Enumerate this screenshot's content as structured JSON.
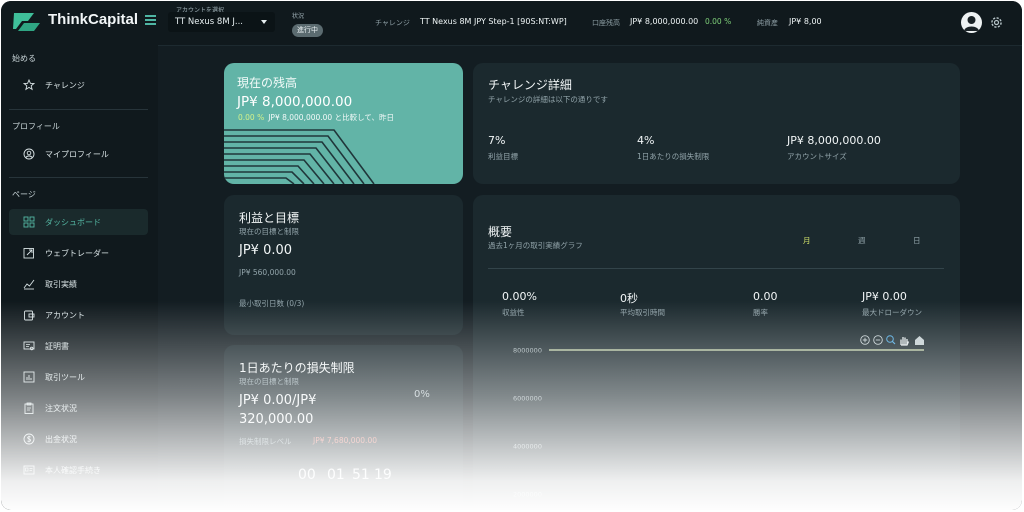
{
  "brand": "ThinkCapital",
  "topbar": {
    "account_label": "アカウントを選択",
    "account_value": "TT Nexus 8M J...",
    "status_label": "状況",
    "status_value": "進行中",
    "challenge_label": "チャレンジ",
    "challenge_value": "TT Nexus 8M JPY Step-1 [90S:NT:WP]",
    "balance_label": "口座残高",
    "balance_value": "JP¥ 8,000,000.00",
    "balance_pct": "0.00 %",
    "equity_label": "純資産",
    "equity_value": "JP¥ 8,00"
  },
  "sidebar": {
    "sections": [
      {
        "title": "始める",
        "items": [
          {
            "label": "チャレンジ",
            "icon": "star-icon"
          }
        ]
      },
      {
        "title": "プロフィール",
        "items": [
          {
            "label": "マイプロフィール",
            "icon": "user-circle-icon"
          }
        ]
      },
      {
        "title": "ページ",
        "items": [
          {
            "label": "ダッシュボード",
            "icon": "grid-icon",
            "active": true
          },
          {
            "label": "ウェブトレーダー",
            "icon": "external-link-icon"
          },
          {
            "label": "取引実績",
            "icon": "chart-line-icon"
          },
          {
            "label": "アカウント",
            "icon": "wallet-icon"
          },
          {
            "label": "証明書",
            "icon": "certificate-icon"
          },
          {
            "label": "取引ツール",
            "icon": "bar-chart-icon"
          },
          {
            "label": "注文状況",
            "icon": "clipboard-icon"
          },
          {
            "label": "出金状況",
            "icon": "dollar-icon"
          },
          {
            "label": "本人確認手続き",
            "icon": "id-card-icon"
          }
        ]
      }
    ]
  },
  "balance_card": {
    "title": "現在の残高",
    "value": "JP¥ 8,000,000.00",
    "pct": "0.00 %",
    "compare": "JP¥ 8,000,000.00 と比較して、昨日"
  },
  "challenge_details": {
    "title": "チャレンジ詳細",
    "subtitle": "チャレンジの詳細は以下の通りです",
    "metrics": [
      {
        "value": "7%",
        "label": "利益目標"
      },
      {
        "value": "4%",
        "label": "1日あたりの損失制限"
      },
      {
        "value": "JP¥ 8,000,000.00",
        "label": "アカウントサイズ"
      }
    ]
  },
  "profit_card": {
    "title": "利益と目標",
    "subtitle": "現在の目標と制限",
    "value": "JP¥ 0.00",
    "target": "JP¥ 560,000.00",
    "min_days": "最小取引日数 (0/3)"
  },
  "daily_loss_card": {
    "title": "1日あたりの損失制限",
    "subtitle": "現在の目標と制限",
    "value_line1": "JP¥ 0.00/JP¥",
    "value_line2": "320,000.00",
    "pct": "0%",
    "level_label": "損失制限レベル",
    "level_value": "JP¥ 7,680,000.00"
  },
  "timer": {
    "hh": "00",
    "mm": "01",
    "ss": "51",
    "xx": "19"
  },
  "overview": {
    "title": "概要",
    "subtitle": "過去1ヶ月の取引実績グラフ",
    "tabs": [
      "月",
      "週",
      "日"
    ],
    "active_tab": "月",
    "metrics": [
      {
        "value": "0.00%",
        "label": "収益性"
      },
      {
        "value": "0秒",
        "label": "平均取引時間"
      },
      {
        "value": "0.00",
        "label": "勝率"
      },
      {
        "value": "JP¥ 0.00",
        "label": "最大ドローダウン"
      }
    ],
    "toolbar_icons": [
      "zoom-in-icon",
      "zoom-out-icon",
      "zoom-select-icon",
      "pan-hand-icon",
      "home-icon"
    ]
  },
  "chart_data": {
    "type": "line",
    "series": [
      {
        "values": [
          8000000,
          8000000
        ]
      }
    ],
    "yticks": [
      "8000000",
      "6000000",
      "4000000",
      "2000000"
    ],
    "ylim": [
      2000000,
      8000000
    ],
    "line_color": "#d7e6b8"
  }
}
